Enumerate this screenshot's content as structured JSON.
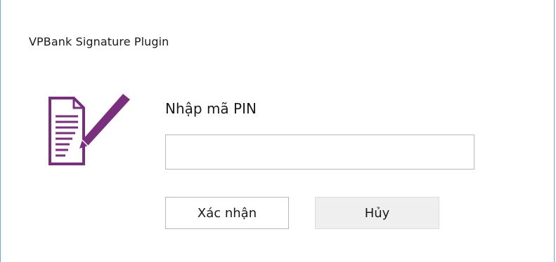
{
  "dialog": {
    "title": "VPBank Signature Plugin",
    "icon": "document-sign-icon",
    "pin_label": "Nhập mã PIN",
    "pin_value": "",
    "pin_placeholder": "",
    "confirm_label": "Xác nhận",
    "cancel_label": "Hủy"
  },
  "colors": {
    "icon_purple": "#7a2e7e",
    "border_blue": "#6fa8dc"
  }
}
